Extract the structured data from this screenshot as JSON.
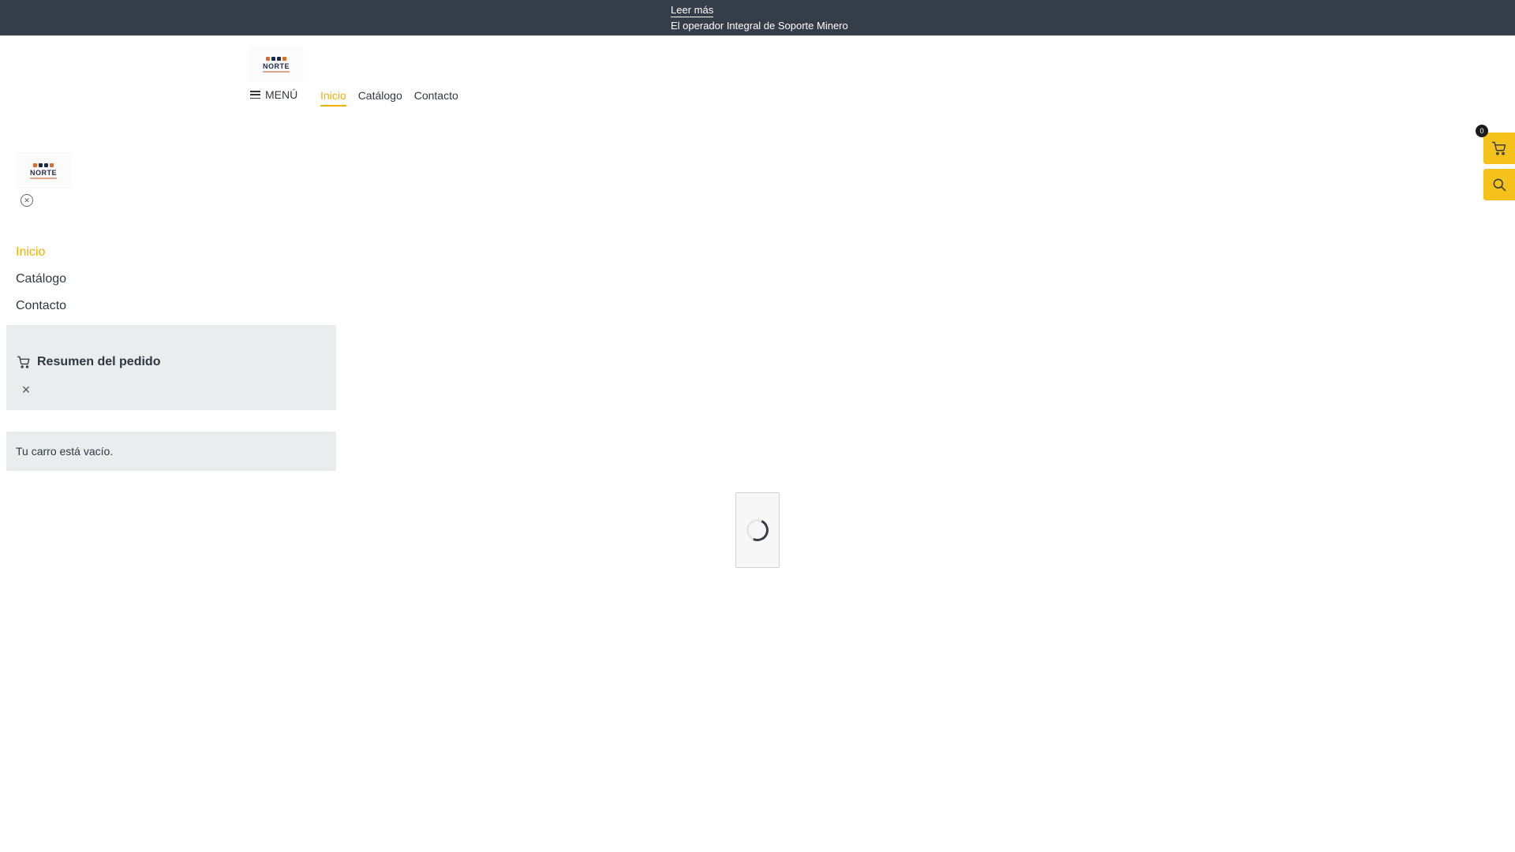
{
  "topbar": {
    "read_more": "Leer más",
    "tagline": "El operador Integral de Soporte Minero"
  },
  "brand": {
    "logo_word": "NORTE",
    "accent_color": "#f5c21b",
    "active_color": "#f0b000",
    "bar_color": "#343d48"
  },
  "header": {
    "menu_label": "MENÚ",
    "nav": [
      {
        "label": "Inicio",
        "active": true
      },
      {
        "label": "Catálogo",
        "active": false
      },
      {
        "label": "Contacto",
        "active": false
      }
    ]
  },
  "floating": {
    "cart_count": "0",
    "cart_icon": "cart-icon",
    "search_icon": "search-icon"
  },
  "side_menu": {
    "items": [
      {
        "label": "Inicio",
        "active": true
      },
      {
        "label": "Catálogo",
        "active": false
      },
      {
        "label": "Contacto",
        "active": false
      }
    ],
    "close_icon": "close-circle-icon"
  },
  "cart_panel": {
    "title": "Resumen del pedido",
    "empty_message": "Tu carro está vacío.",
    "close_icon": "close-icon"
  }
}
